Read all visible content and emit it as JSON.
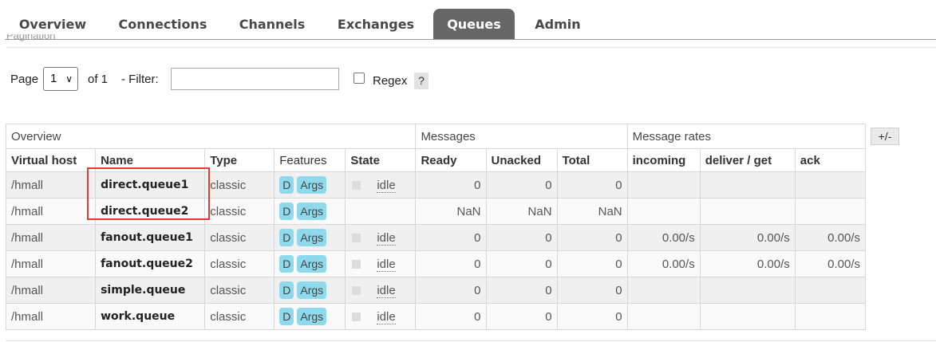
{
  "nav": {
    "tabs": [
      {
        "label": "Overview",
        "active": false
      },
      {
        "label": "Connections",
        "active": false
      },
      {
        "label": "Channels",
        "active": false
      },
      {
        "label": "Exchanges",
        "active": false
      },
      {
        "label": "Queues",
        "active": true
      },
      {
        "label": "Admin",
        "active": false
      }
    ]
  },
  "pagination": {
    "legend": "Pagination",
    "page_label": "Page",
    "page_value": "1",
    "of_label": "of 1",
    "filter_label": "- Filter:",
    "filter_value": "",
    "regex_label": "Regex",
    "regex_checked": false,
    "help_label": "?"
  },
  "table": {
    "plus_minus": "+/-",
    "groups": [
      "Overview",
      "Messages",
      "Message rates"
    ],
    "headers": [
      "Virtual host",
      "Name",
      "Type",
      "Features",
      "State",
      "Ready",
      "Unacked",
      "Total",
      "incoming",
      "deliver / get",
      "ack"
    ],
    "rows": [
      {
        "vhost": "/hmall",
        "name": "direct.queue1",
        "type": "classic",
        "features": [
          "D",
          "Args"
        ],
        "state": "idle",
        "ready": "0",
        "unacked": "0",
        "total": "0",
        "incoming": "",
        "deliver_get": "",
        "ack": ""
      },
      {
        "vhost": "/hmall",
        "name": "direct.queue2",
        "type": "classic",
        "features": [
          "D",
          "Args"
        ],
        "state": "",
        "ready": "NaN",
        "unacked": "NaN",
        "total": "NaN",
        "incoming": "",
        "deliver_get": "",
        "ack": ""
      },
      {
        "vhost": "/hmall",
        "name": "fanout.queue1",
        "type": "classic",
        "features": [
          "D",
          "Args"
        ],
        "state": "idle",
        "ready": "0",
        "unacked": "0",
        "total": "0",
        "incoming": "0.00/s",
        "deliver_get": "0.00/s",
        "ack": "0.00/s"
      },
      {
        "vhost": "/hmall",
        "name": "fanout.queue2",
        "type": "classic",
        "features": [
          "D",
          "Args"
        ],
        "state": "idle",
        "ready": "0",
        "unacked": "0",
        "total": "0",
        "incoming": "0.00/s",
        "deliver_get": "0.00/s",
        "ack": "0.00/s"
      },
      {
        "vhost": "/hmall",
        "name": "simple.queue",
        "type": "classic",
        "features": [
          "D",
          "Args"
        ],
        "state": "idle",
        "ready": "0",
        "unacked": "0",
        "total": "0",
        "incoming": "",
        "deliver_get": "",
        "ack": ""
      },
      {
        "vhost": "/hmall",
        "name": "work.queue",
        "type": "classic",
        "features": [
          "D",
          "Args"
        ],
        "state": "idle",
        "ready": "0",
        "unacked": "0",
        "total": "0",
        "incoming": "",
        "deliver_get": "",
        "ack": ""
      }
    ]
  },
  "colors": {
    "active_tab": "#666666",
    "feature_badge": "#8fd9ec",
    "highlight_box": "#e53935"
  }
}
